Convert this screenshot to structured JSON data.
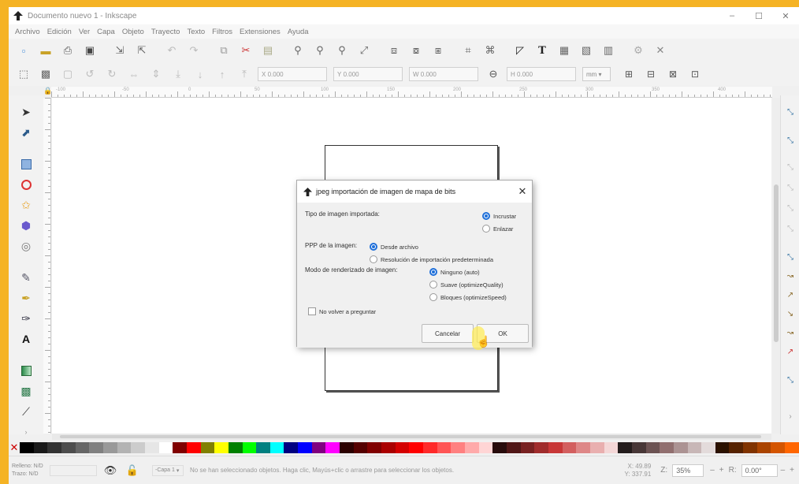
{
  "window": {
    "title": "Documento nuevo 1 - Inkscape",
    "controls": [
      "–",
      "☐",
      "✕"
    ]
  },
  "menubar": [
    "Archivo",
    "Edición",
    "Ver",
    "Capa",
    "Objeto",
    "Trayecto",
    "Texto",
    "Filtros",
    "Extensiones",
    "Ayuda"
  ],
  "command_icons": [
    "new-icon",
    "open-icon",
    "print-icon",
    "save-icon",
    "import-icon",
    "export-icon",
    "undo-icon",
    "redo-icon",
    "copy-icon",
    "cut-icon",
    "paste-icon",
    "zoom-selection-icon",
    "zoom-drawing-icon",
    "zoom-page-icon",
    "zoom-fit-icon",
    "duplicate-icon",
    "clone-icon",
    "unlink-clone-icon",
    "group-icon",
    "ungroup-icon",
    "fill-stroke-icon",
    "text-font-icon",
    "layers-icon",
    "xml-editor-icon",
    "align-icon",
    "preferences-icon",
    "document-properties-icon"
  ],
  "controls_bar": {
    "x_label": "X",
    "x_value": "0.000",
    "y_label": "Y",
    "y_value": "0.000",
    "w_label": "W",
    "w_value": "0.000",
    "h_label": "H",
    "h_value": "0.000",
    "unit": "mm"
  },
  "ruler_labels": [
    "-100",
    "-50",
    "0",
    "50",
    "100",
    "150",
    "200",
    "250",
    "300",
    "350",
    "400"
  ],
  "tools": [
    "selector-icon",
    "node-icon",
    "rectangle-icon",
    "circle-icon",
    "star-icon",
    "3d-box-icon",
    "spiral-icon",
    "pencil-icon",
    "pen-icon",
    "calligraphy-icon",
    "text-icon",
    "gradient-icon",
    "mesh-icon",
    "dropper-icon"
  ],
  "dialog": {
    "title": "jpeg importación de imagen de mapa de bits",
    "close": "✕",
    "import_type_label": "Tipo de imagen importada:",
    "import_opt1": "Incrustar",
    "import_opt2": "Enlazar",
    "dpi_label": "PPP de la imagen:",
    "dpi_opt1": "Desde archivo",
    "dpi_opt2": "Resolución de importación predeterminada",
    "render_label": "Modo de renderizado de imagen:",
    "render_opt1": "Ninguno (auto)",
    "render_opt2": "Suave (optimizeQuality)",
    "render_opt3": "Bloques (optimizeSpeed)",
    "dont_ask": "No volver a preguntar",
    "cancel": "Cancelar",
    "ok": "OK"
  },
  "palette_colors": [
    "#000000",
    "#1a1a1a",
    "#333333",
    "#4d4d4d",
    "#666666",
    "#808080",
    "#999999",
    "#b3b3b3",
    "#cccccc",
    "#e6e6e6",
    "#ffffff",
    "#800000",
    "#ff0000",
    "#808000",
    "#ffff00",
    "#008000",
    "#00ff00",
    "#008080",
    "#00ffff",
    "#000080",
    "#0000ff",
    "#800080",
    "#ff00ff",
    "#2b0000",
    "#550000",
    "#800000",
    "#aa0000",
    "#d40000",
    "#ff0000",
    "#ff2a2a",
    "#ff5555",
    "#ff8080",
    "#ffaaaa",
    "#ffd5d5",
    "#280b0b",
    "#501616",
    "#782121",
    "#a02c2c",
    "#c83737",
    "#d35f5f",
    "#de8787",
    "#e9afaf",
    "#f4d7d7",
    "#241c1c",
    "#483737",
    "#6c5353",
    "#916f6f",
    "#ac9393",
    "#c8b7b7",
    "#e3dbdb",
    "#2b1100",
    "#552200",
    "#803300",
    "#aa4400",
    "#d45500",
    "#ff6600"
  ],
  "status": {
    "fill_label": "Relleno:",
    "fill_value": "N/D",
    "stroke_label": "Trazo:",
    "stroke_value": "N/D",
    "layer": "-Capa 1",
    "message": "No se han seleccionado objetos. Haga clic, Mayús+clic o arrastre para seleccionar los objetos.",
    "x_coord": "X: 49.89",
    "y_coord": "Y: 337.91",
    "zoom_label": "Z:",
    "zoom": "35%",
    "rot_label": "R:",
    "rotation": "0.00°",
    "minus": "–",
    "plus": "+"
  }
}
